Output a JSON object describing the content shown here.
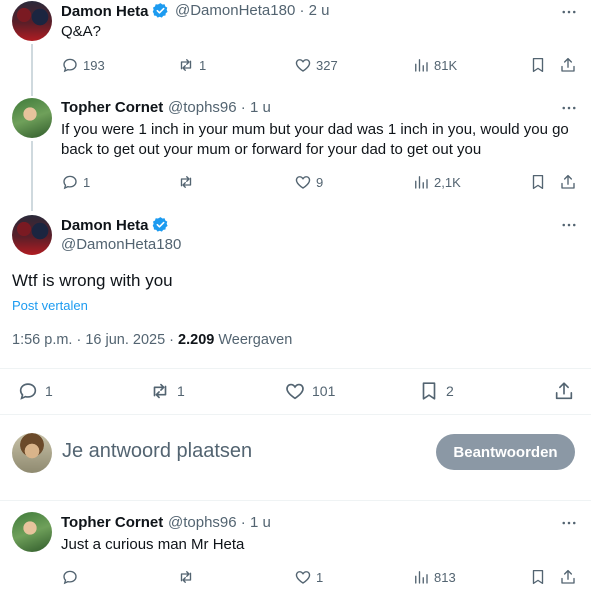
{
  "tweets": [
    {
      "name": "Damon Heta",
      "handle": "@DamonHeta180",
      "time": "· 2 u",
      "text": "Q&A?",
      "replies": "193",
      "reposts": "1",
      "likes": "327",
      "views": "81K"
    },
    {
      "name": "Topher Cornet",
      "handle": "@tophs96",
      "time": "· 1 u",
      "text_line1": "If you were 1 inch in your mum but your dad was 1 inch in you, would you go",
      "text_line2": "back to get out your mum or forward for your dad to get out you",
      "replies": "1",
      "reposts": "",
      "likes": "9",
      "views": "2,1K"
    }
  ],
  "main_tweet": {
    "name": "Damon Heta",
    "handle": "@DamonHeta180",
    "text": "Wtf is wrong with you",
    "translate": "Post vertalen",
    "timestamp": "1:56 p.m. · 16 jun. 2025 · ",
    "views_count": "2.209",
    "views_label": " Weergaven",
    "replies": "1",
    "reposts": "1",
    "likes": "101",
    "bookmarks": "2"
  },
  "compose": {
    "placeholder": "Je antwoord plaatsen",
    "button": "Beantwoorden"
  },
  "reply": {
    "name": "Topher Cornet",
    "handle": "@tophs96",
    "time": "· 1 u",
    "text": "Just a curious man Mr Heta",
    "replies": "",
    "reposts": "",
    "likes": "1",
    "views": "813"
  },
  "colors": {
    "verified": "#1d9bf0",
    "link": "#1d9bf0",
    "muted": "#536471",
    "button_disabled": "#8b98a5"
  }
}
